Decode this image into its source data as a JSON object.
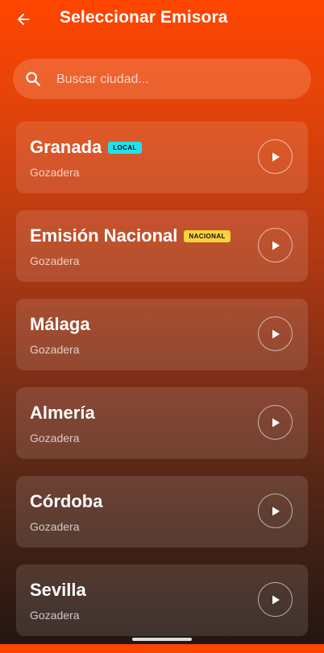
{
  "header": {
    "title": "Seleccionar Emisora",
    "back_icon": "arrow-left-icon"
  },
  "search": {
    "placeholder": "Buscar ciudad...",
    "value": "",
    "icon": "search-icon"
  },
  "stations": [
    {
      "name": "Granada",
      "subtitle": "Gozadera",
      "badge": "LOCAL",
      "badge_color": "#22e0ee"
    },
    {
      "name": "Emisión Nacional",
      "subtitle": "Gozadera",
      "badge": "NACIONAL",
      "badge_color": "#ffd23c"
    },
    {
      "name": "Málaga",
      "subtitle": "Gozadera",
      "badge": null
    },
    {
      "name": "Almería",
      "subtitle": "Gozadera",
      "badge": null
    },
    {
      "name": "Córdoba",
      "subtitle": "Gozadera",
      "badge": null
    },
    {
      "name": "Sevilla",
      "subtitle": "Gozadera",
      "badge": null
    }
  ],
  "colors": {
    "accent": "#ff4500",
    "text": "#ffffff"
  },
  "icons": {
    "play": "play-icon"
  }
}
